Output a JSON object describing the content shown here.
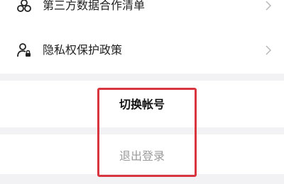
{
  "settings_list": {
    "items": [
      {
        "label": "第三方数据合作清单",
        "icon": "people-icon"
      },
      {
        "label": "隐私权保护政策",
        "icon": "user-lock-icon"
      }
    ]
  },
  "account": {
    "switch_account_label": "切换帐号",
    "logout_label": "退出登录"
  },
  "colors": {
    "highlight": "#d8353f",
    "logout_text": "#9a9a9a",
    "background": "#f2f2f4"
  }
}
